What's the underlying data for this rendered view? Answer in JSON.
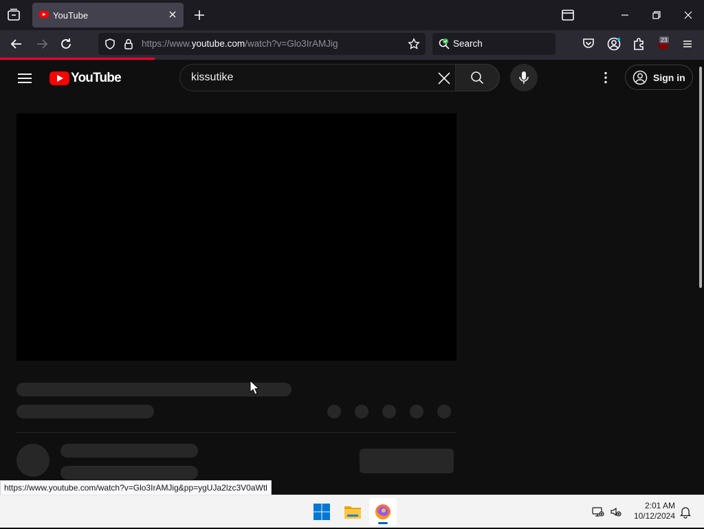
{
  "browser": {
    "tab": {
      "title": "YouTube"
    },
    "url": {
      "prefix": "https://www.",
      "host": "youtube.com",
      "path": "/watch?v=Glo3IrAMJig"
    },
    "search": {
      "label": "Search"
    },
    "extension_badge": "23",
    "load_progress": 0.22,
    "status_link": "https://www.youtube.com/watch?v=Glo3IrAMJig&pp=ygUJa2lzc3V0aWtl"
  },
  "youtube": {
    "logo_text": "YouTube",
    "search_query": "kissutike",
    "sign_in_label": "Sign in"
  },
  "taskbar": {
    "time": "2:01 AM",
    "date": "10/12/2024"
  },
  "colors": {
    "youtube_red": "#ff0000",
    "page_background": "#0f0f0f",
    "skeleton": "#272727",
    "taskbar": "#f3f3f3"
  }
}
